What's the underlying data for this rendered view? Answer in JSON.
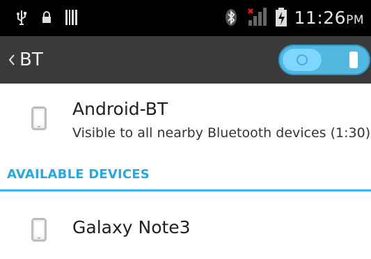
{
  "status_bar": {
    "time": "11:26",
    "ampm": "PM",
    "icons": [
      "usb-icon",
      "lock-icon",
      "barcode-icon",
      "bluetooth-icon",
      "signal-icon",
      "battery-icon"
    ]
  },
  "action_bar": {
    "title": "BT",
    "toggle_state": "on"
  },
  "this_device": {
    "name": "Android-BT",
    "visibility_text": "Visible to all nearby Bluetooth devices (1:30)"
  },
  "available_devices": {
    "section_title": "AVAILABLE DEVICES",
    "items": [
      {
        "name": "Galaxy Note3"
      }
    ]
  },
  "colors": {
    "accent": "#35b6e8",
    "actionbar": "#3a3a3a",
    "statusbar": "#000000"
  }
}
